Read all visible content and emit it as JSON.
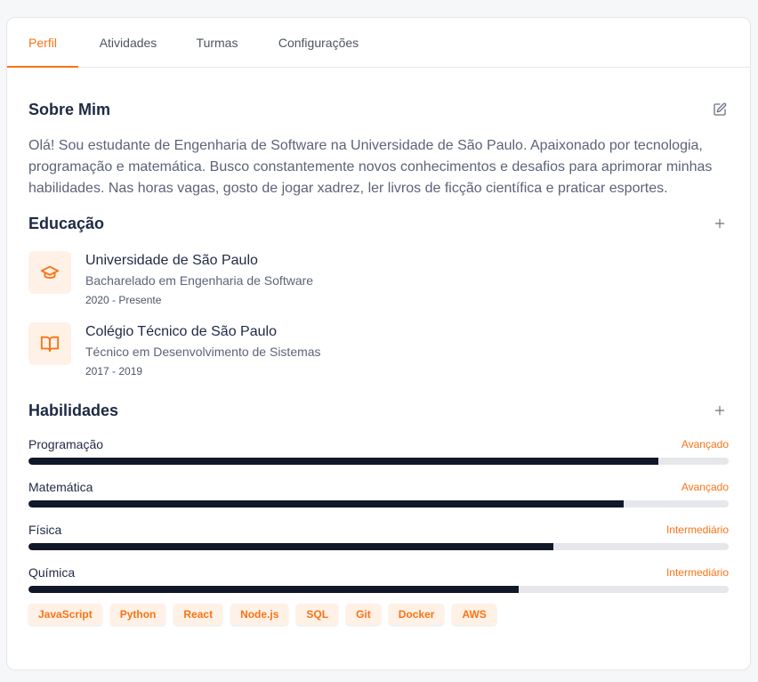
{
  "tabs": [
    {
      "label": "Perfil",
      "active": true
    },
    {
      "label": "Atividades",
      "active": false
    },
    {
      "label": "Turmas",
      "active": false
    },
    {
      "label": "Configurações",
      "active": false
    }
  ],
  "about": {
    "title": "Sobre Mim",
    "text": "Olá! Sou estudante de Engenharia de Software na Universidade de São Paulo. Apaixonado por tecnologia, programação e matemática. Busco constantemente novos conhecimentos e desafios para aprimorar minhas habilidades. Nas horas vagas, gosto de jogar xadrez, ler livros de ficção científica e praticar esportes."
  },
  "education": {
    "title": "Educação",
    "items": [
      {
        "name": "Universidade de São Paulo",
        "degree": "Bacharelado em Engenharia de Software",
        "period": "2020 - Presente",
        "icon": "graduation-cap-icon"
      },
      {
        "name": "Colégio Técnico de São Paulo",
        "degree": "Técnico em Desenvolvimento de Sistemas",
        "period": "2017 - 2019",
        "icon": "book-icon"
      }
    ]
  },
  "skills": {
    "title": "Habilidades",
    "items": [
      {
        "name": "Programação",
        "level": "Avançado",
        "progress": 0.9
      },
      {
        "name": "Matemática",
        "level": "Avançado",
        "progress": 0.85
      },
      {
        "name": "Física",
        "level": "Intermediário",
        "progress": 0.75
      },
      {
        "name": "Química",
        "level": "Intermediário",
        "progress": 0.7
      }
    ],
    "tags": [
      "JavaScript",
      "Python",
      "React",
      "Node.js",
      "SQL",
      "Git",
      "Docker",
      "AWS"
    ]
  },
  "colors": {
    "accent": "#f97316",
    "bar_fill": "#0f1729",
    "bar_track": "#e5e7eb"
  }
}
